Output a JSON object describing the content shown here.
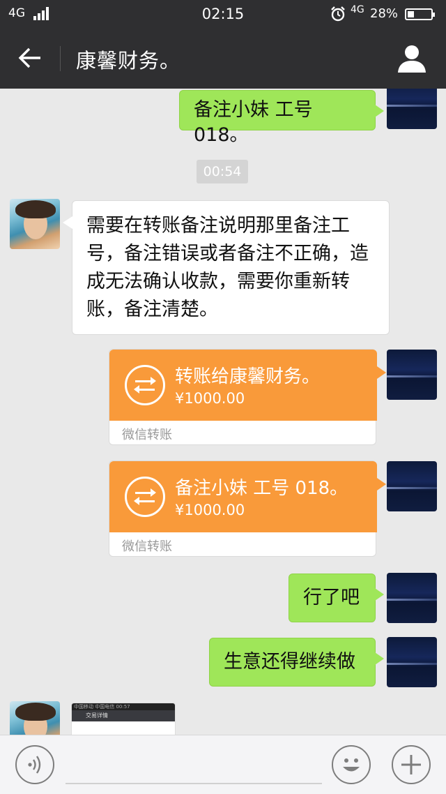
{
  "status_bar": {
    "network_left": "4G",
    "time": "02:15",
    "network_right": "4G",
    "battery_text": "28%",
    "battery_level": 0.28
  },
  "header": {
    "title": "康馨财务。",
    "back_icon": "back-arrow-icon",
    "profile_icon": "person-icon"
  },
  "messages": {
    "m1_text": "备注小妹 工号 018。",
    "time_chip": "00:54",
    "m2_text": "需要在转账备注说明那里备注工号，备注错误或者备注不正确，造成无法确认收款，需要你重新转账，备注清楚。",
    "transfer1": {
      "title": "转账给康馨财务。",
      "amount": "¥1000.00",
      "footer": "微信转账"
    },
    "transfer2": {
      "title": "备注小妹 工号 018。",
      "amount": "¥1000.00",
      "footer": "微信转账"
    },
    "m3_text": "行了吧",
    "m4_text": "生意还得继续做",
    "thumb_bar1": "中国移动 中国电信  00:57",
    "thumb_bar2": "交易详情"
  },
  "input_bar": {
    "voice_icon": "voice-icon",
    "emoji_icon": "emoji-icon",
    "plus_icon": "plus-icon"
  }
}
